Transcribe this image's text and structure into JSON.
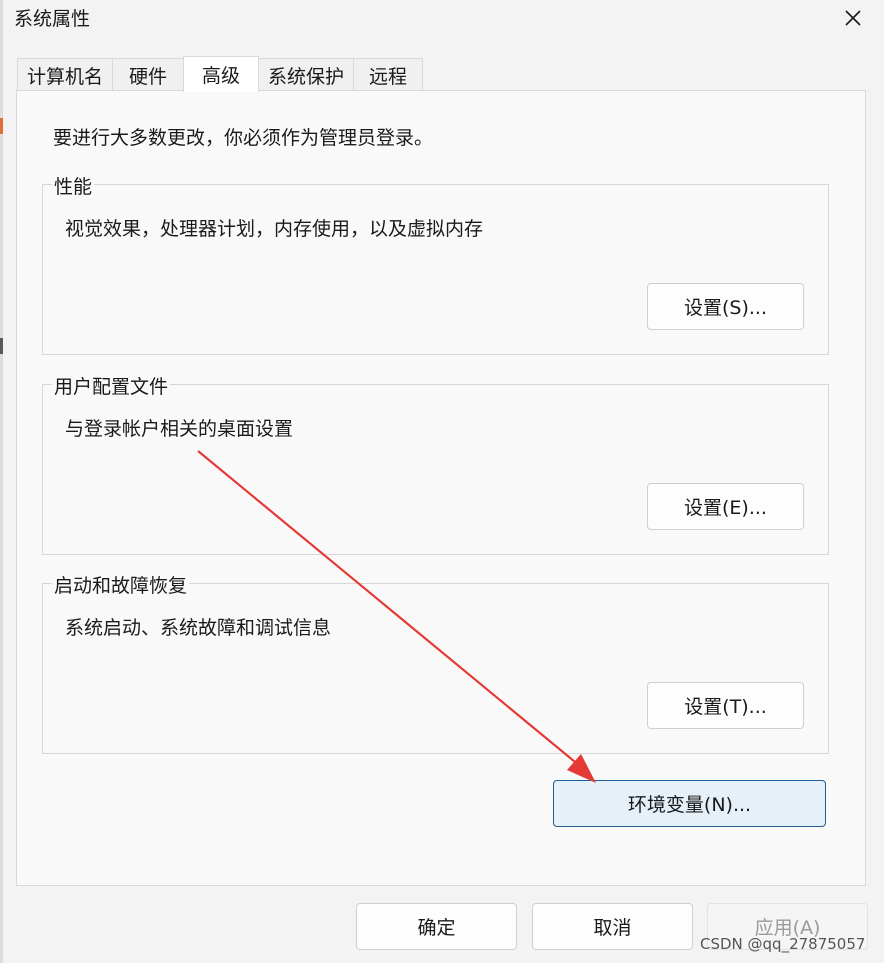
{
  "window": {
    "title": "系统属性",
    "close_icon": "close-icon"
  },
  "tabs": [
    {
      "label": "计算机名",
      "active": false
    },
    {
      "label": "硬件",
      "active": false
    },
    {
      "label": "高级",
      "active": true
    },
    {
      "label": "系统保护",
      "active": false
    },
    {
      "label": "远程",
      "active": false
    }
  ],
  "advanced": {
    "note": "要进行大多数更改，你必须作为管理员登录。",
    "performance": {
      "title": "性能",
      "description": "视觉效果，处理器计划，内存使用，以及虚拟内存",
      "button_label": "设置(S)..."
    },
    "user_profiles": {
      "title": "用户配置文件",
      "description": "与登录帐户相关的桌面设置",
      "button_label": "设置(E)..."
    },
    "startup_recovery": {
      "title": "启动和故障恢复",
      "description": "系统启动、系统故障和调试信息",
      "button_label": "设置(T)..."
    },
    "env_button_label": "环境变量(N)..."
  },
  "footer": {
    "ok_label": "确定",
    "cancel_label": "取消",
    "apply_label": "应用(A)"
  },
  "annotation": {
    "color": "#e53935"
  },
  "watermark": "CSDN @qq_27875057"
}
